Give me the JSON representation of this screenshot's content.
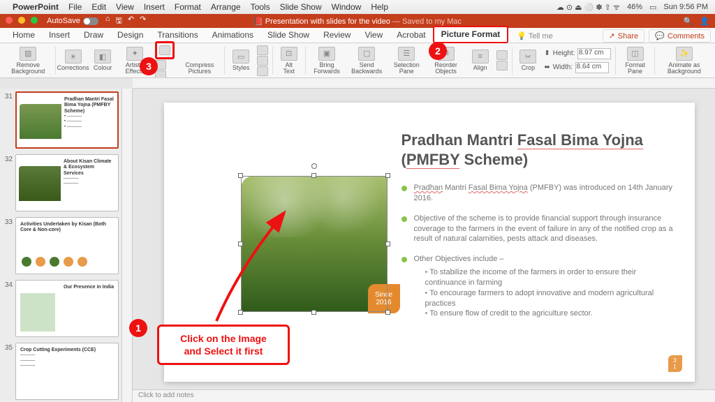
{
  "mac": {
    "app": "PowerPoint",
    "menus": [
      "File",
      "Edit",
      "View",
      "Insert",
      "Format",
      "Arrange",
      "Tools",
      "Slide Show",
      "Window",
      "Help"
    ],
    "battery": "46%",
    "clock": "Sun 9:56 PM"
  },
  "titlebar": {
    "autosave_label": "AutoSave",
    "doc_title": "Presentation with slides for the video",
    "saved_suffix": " — Saved to my Mac"
  },
  "tabs": {
    "items": [
      "Home",
      "Insert",
      "Draw",
      "Design",
      "Transitions",
      "Animations",
      "Slide Show",
      "Review",
      "View",
      "Acrobat",
      "Picture Format"
    ],
    "active": "Picture Format",
    "tellme": "Tell me",
    "share": "Share",
    "comments": "Comments"
  },
  "ribbon": {
    "remove_bg": "Remove Background",
    "corrections": "Corrections",
    "colour": "Colour",
    "artistic": "Artistic Effects",
    "compress": "Compress Pictures",
    "styles": "Styles",
    "alt_text": "Alt Text",
    "bring_fwd": "Bring Forwards",
    "send_back": "Send Backwards",
    "sel_pane": "Selection Pane",
    "reorder": "Reorder Objects",
    "align": "Align",
    "crop": "Crop",
    "height_label": "Height:",
    "height_val": "8.97 cm",
    "width_label": "Width:",
    "width_val": "8.64 cm",
    "format_pane": "Format Pane",
    "animate_bg": "Animate as Background"
  },
  "thumbs": {
    "start_num": 31,
    "items": [
      {
        "title": "Pradhan Mantri Fasal Bima Yojna (PMFBY Scheme)"
      },
      {
        "title": "About Kisan Climate & Ecosystem Services"
      },
      {
        "title": "Activities Undertaken by Kisan (Both Core & Non-core)"
      },
      {
        "title": "Our Presence in India"
      },
      {
        "title": "Crop Cutting Experiments (CCE)"
      }
    ]
  },
  "slide": {
    "title_part1": "Pradhan Mantri ",
    "title_part2": "Fasal Bima Yojna",
    "title_line2a": "(",
    "title_line2b": "PMFBY",
    "title_line2c": " Scheme)",
    "b1_a": "Pradhan",
    "b1_b": " Mantri ",
    "b1_c": "Fasal Bima Yojna",
    "b1_d": " (PMFBY) was introduced on 14th January 2016.",
    "b2": "Objective of the scheme is to provide financial support through insurance coverage to the farmers in the event  of failure in any of the notified crop as a result of natural calamities, pests attack and diseases.",
    "b3": "Other Objectives include –",
    "b3s1": "To stabilize the income of the farmers in order to ensure their continuance in farming",
    "b3s2": "To encourage farmers to adopt innovative and modern agricultural practices",
    "b3s3": "To ensure flow of credit to the agriculture sector.",
    "since_label": "Since",
    "since_year": "2016",
    "page_num_a": "3",
    "page_num_b": "1"
  },
  "callout": {
    "line1": "Click on the Image",
    "line2": "and Select it first"
  },
  "notes": {
    "placeholder": "Click to add notes"
  },
  "badges": {
    "one": "1",
    "two": "2",
    "three": "3"
  }
}
